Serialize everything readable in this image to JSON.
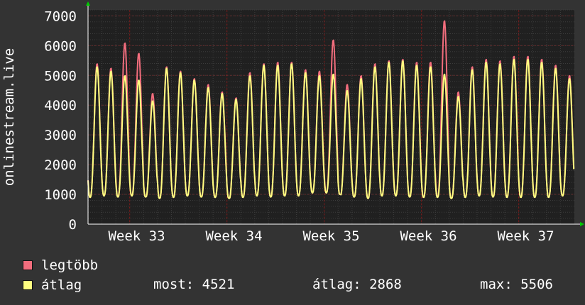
{
  "chart_data": {
    "type": "line",
    "ylabel": "onlinestream.live",
    "ylim": [
      0,
      7200
    ],
    "yticks": [
      0,
      1000,
      2000,
      3000,
      4000,
      5000,
      6000,
      7000
    ],
    "xticks": [
      "Week 33",
      "Week 34",
      "Week 35",
      "Week 36",
      "Week 37"
    ],
    "grid": true,
    "series": [
      {
        "name": "legtöbb",
        "color": "#f26d7d",
        "daily_peaks": [
          5400,
          5250,
          6100,
          5750,
          4400,
          5300,
          5150,
          4900,
          4700,
          4450,
          4250,
          5100,
          5400,
          5450,
          5450,
          5200,
          5150,
          6200,
          4700,
          5000,
          5400,
          5500,
          5550,
          5450,
          5450,
          6850,
          4450,
          5300,
          5550,
          5500,
          5650,
          5650,
          5550,
          5350,
          5000
        ],
        "daily_lows": [
          900,
          950,
          900,
          950,
          900,
          850,
          900,
          950,
          900,
          900,
          850,
          900,
          950,
          900,
          950,
          950,
          1050,
          1050,
          950,
          900,
          850,
          950,
          950,
          900,
          900,
          900,
          850,
          900,
          950,
          900,
          900,
          900,
          900,
          900,
          950
        ]
      },
      {
        "name": "átlag",
        "color": "#ffff80",
        "daily_peaks": [
          5300,
          5150,
          5000,
          4850,
          4150,
          5250,
          5100,
          4850,
          4600,
          4400,
          4200,
          5000,
          5350,
          5350,
          5400,
          5100,
          5000,
          5050,
          4500,
          4900,
          5300,
          5450,
          5500,
          5350,
          5300,
          5050,
          4300,
          5200,
          5450,
          5400,
          5550,
          5550,
          5450,
          5250,
          4900
        ],
        "daily_lows": [
          900,
          950,
          900,
          950,
          900,
          850,
          900,
          950,
          900,
          900,
          850,
          900,
          950,
          900,
          950,
          950,
          1050,
          1050,
          950,
          900,
          850,
          950,
          950,
          900,
          900,
          900,
          850,
          900,
          950,
          900,
          900,
          900,
          900,
          900,
          950
        ]
      }
    ]
  },
  "legend": {
    "max_label": "legtöbb",
    "avg_label": "átlag"
  },
  "stats": {
    "now": "most: 4521",
    "avg": "átlag: 2868",
    "max": "max: 5506"
  },
  "colors": {
    "background": "#333333",
    "plot_bg": "#202020",
    "grid": "#3c3c3c",
    "vgrid": "#8b1a1a",
    "axis": "#ffffff"
  }
}
